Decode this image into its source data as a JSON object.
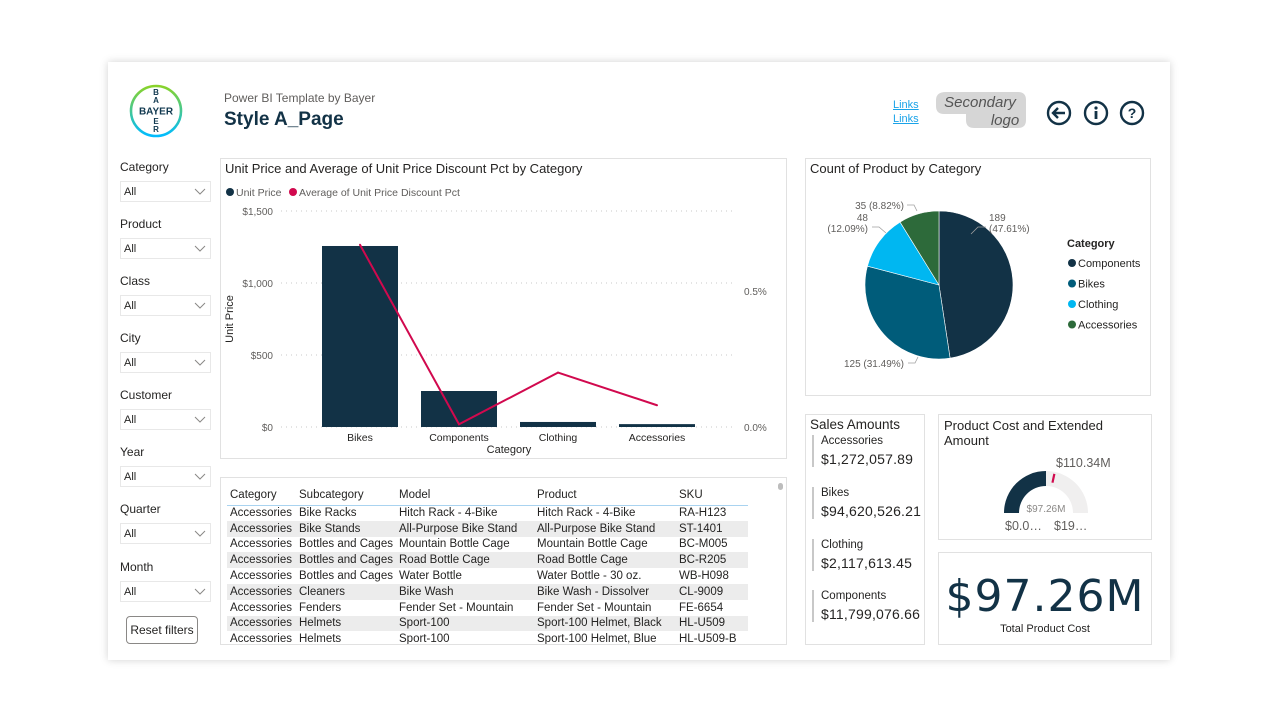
{
  "header": {
    "subtitle": "Power BI Template by Bayer",
    "title": "Style A_Page",
    "logo_text": "BAYER",
    "links": [
      "Links",
      "Links"
    ],
    "secondary_logo": [
      "Secondary",
      "logo"
    ],
    "icons": [
      "back-arrow-icon",
      "info-icon",
      "help-icon"
    ]
  },
  "slicers": [
    {
      "label": "Category",
      "value": "All"
    },
    {
      "label": "Product",
      "value": "All"
    },
    {
      "label": "Class",
      "value": "All"
    },
    {
      "label": "City",
      "value": "All"
    },
    {
      "label": "Customer",
      "value": "All"
    },
    {
      "label": "Year",
      "value": "All"
    },
    {
      "label": "Quarter",
      "value": "All"
    },
    {
      "label": "Month",
      "value": "All"
    }
  ],
  "reset_button": "Reset filters",
  "colors": {
    "navy": "#123246",
    "teal": "#005c7a",
    "cyan": "#00b7f1",
    "green": "#2d6a3a",
    "crimson": "#d1094e",
    "gauge_bg": "#f0efef"
  },
  "chart_data": [
    {
      "type": "bar",
      "title": "Unit Price and Average of Unit Price Discount Pct by Category",
      "categories": [
        "Bikes",
        "Components",
        "Clothing",
        "Accessories"
      ],
      "series": [
        {
          "name": "Unit Price",
          "type": "bar",
          "axis": "left",
          "values": [
            1257,
            250,
            35,
            20
          ]
        },
        {
          "name": "Average of Unit Price Discount Pct",
          "type": "line",
          "axis": "right",
          "values": [
            0.67,
            0.01,
            0.2,
            0.08
          ]
        }
      ],
      "xlabel": "Category",
      "ylabel": "Unit Price",
      "y2label": "Average of Unit Price Discount Pct",
      "ylim": [
        0,
        1500
      ],
      "y2lim": [
        0,
        0.8
      ],
      "yticks": [
        0,
        500,
        1000,
        1500
      ],
      "ytick_labels": [
        "$0",
        "$500",
        "$1,000",
        "$1,500"
      ],
      "y2ticks": [
        0,
        0.5
      ],
      "y2tick_labels": [
        "0.0%",
        "0.5%"
      ],
      "legend": "top-left",
      "grid": true
    },
    {
      "type": "pie",
      "title": "Count of Product by Category",
      "legend_title": "Category",
      "legend": "right",
      "slices": [
        {
          "label": "Components",
          "value": 189,
          "pct": "47.61%"
        },
        {
          "label": "Bikes",
          "value": 125,
          "pct": "31.49%"
        },
        {
          "label": "Clothing",
          "value": 48,
          "pct": "12.09%"
        },
        {
          "label": "Accessories",
          "value": 35,
          "pct": "8.82%"
        }
      ],
      "data_labels": [
        "189",
        "(47.61%)",
        "125 (31.49%)",
        "48",
        "(12.09%)",
        "35 (8.82%)"
      ]
    }
  ],
  "table": {
    "columns": [
      "Category",
      "Subcategory",
      "Model",
      "Product",
      "SKU"
    ],
    "rows": [
      [
        "Accessories",
        "Bike Racks",
        "Hitch Rack - 4-Bike",
        "Hitch Rack - 4-Bike",
        "RA-H123"
      ],
      [
        "Accessories",
        "Bike Stands",
        "All-Purpose Bike Stand",
        "All-Purpose Bike Stand",
        "ST-1401"
      ],
      [
        "Accessories",
        "Bottles and Cages",
        "Mountain Bottle Cage",
        "Mountain Bottle Cage",
        "BC-M005"
      ],
      [
        "Accessories",
        "Bottles and Cages",
        "Road Bottle Cage",
        "Road Bottle Cage",
        "BC-R205"
      ],
      [
        "Accessories",
        "Bottles and Cages",
        "Water Bottle",
        "Water Bottle - 30 oz.",
        "WB-H098"
      ],
      [
        "Accessories",
        "Cleaners",
        "Bike Wash",
        "Bike Wash - Dissolver",
        "CL-9009"
      ],
      [
        "Accessories",
        "Fenders",
        "Fender Set - Mountain",
        "Fender Set - Mountain",
        "FE-6654"
      ],
      [
        "Accessories",
        "Helmets",
        "Sport-100",
        "Sport-100 Helmet, Black",
        "HL-U509"
      ],
      [
        "Accessories",
        "Helmets",
        "Sport-100",
        "Sport-100 Helmet, Blue",
        "HL-U509-B"
      ]
    ]
  },
  "sales": {
    "title": "Sales Amounts",
    "items": [
      {
        "category": "Accessories",
        "amount": "$1,272,057.89"
      },
      {
        "category": "Bikes",
        "amount": "$94,620,526.21"
      },
      {
        "category": "Clothing",
        "amount": "$2,117,613.45"
      },
      {
        "category": "Components",
        "amount": "$11,799,076.66"
      }
    ]
  },
  "gauge": {
    "title": "Product Cost and Extended Amount",
    "value_label": "$97.26M",
    "target_label": "$110.34M",
    "min_label": "$0.0…",
    "max_label": "$19…",
    "value_fraction": 0.5,
    "target_fraction": 0.567
  },
  "kpi": {
    "value": "$97.26M",
    "label": "Total Product Cost"
  }
}
